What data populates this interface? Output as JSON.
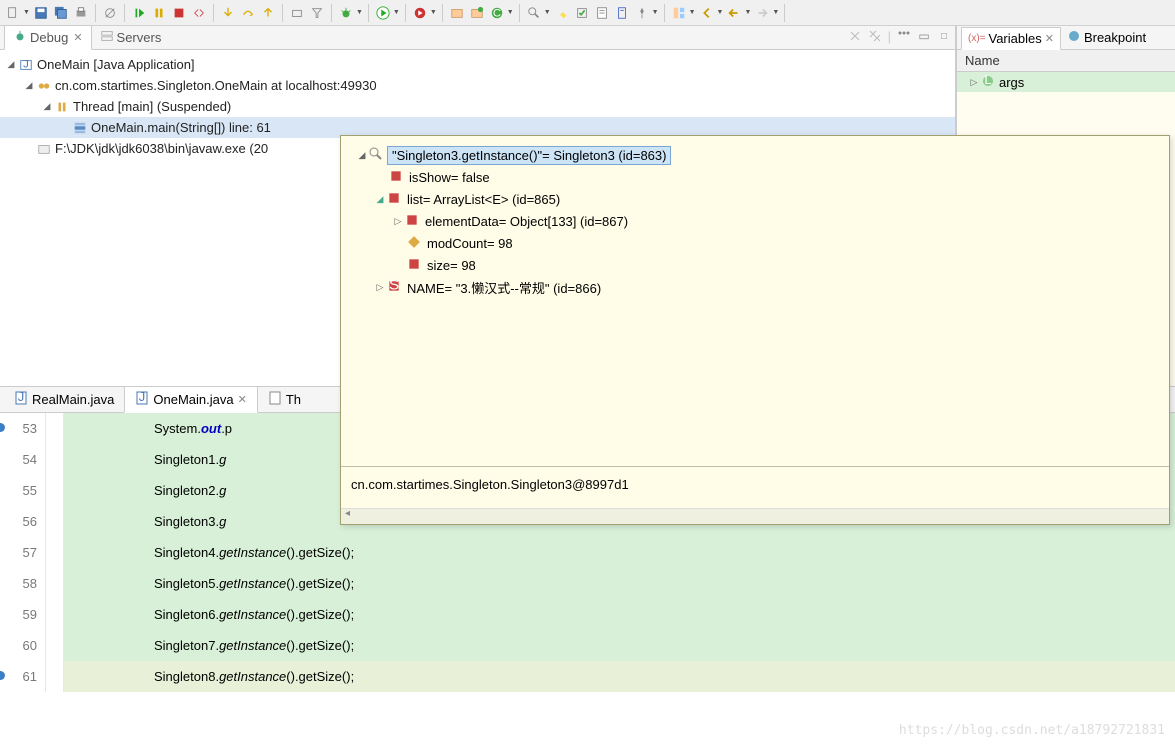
{
  "toolbar": {},
  "debug": {
    "tab_debug": "Debug",
    "tab_servers": "Servers",
    "tree": {
      "n0": "OneMain [Java Application]",
      "n1": "cn.com.startimes.Singleton.OneMain at localhost:49930",
      "n2": "Thread [main] (Suspended)",
      "n3": "OneMain.main(String[]) line: 61",
      "n4": "F:\\JDK\\jdk\\jdk6038\\bin\\javaw.exe (20"
    }
  },
  "vars": {
    "tab_vars": "Variables",
    "tab_bp": "Breakpoint",
    "header": "Name",
    "row0": "args"
  },
  "tooltip": {
    "root": "\"Singleton3.getInstance()\"= Singleton3  (id=863)",
    "isShow": "isShow= false",
    "list": "list= ArrayList<E>  (id=865)",
    "elementData": "elementData= Object[133]  (id=867)",
    "modCount": "modCount= 98",
    "size": "size= 98",
    "name": "NAME= \"3.懒汉式--常规\" (id=866)",
    "footer": "cn.com.startimes.Singleton.Singleton3@8997d1"
  },
  "editor": {
    "tab_real": "RealMain.java",
    "tab_one": "OneMain.java",
    "tab_th": "Th",
    "lines": {
      "l53a": "System.",
      "l53b": "out",
      "l53c": ".p",
      "l54a": "Singleton1.",
      "l54b": "g",
      "l55a": "Singleton2.",
      "l55b": "g",
      "l56a": "Singleton3.",
      "l56b": "g",
      "l57a": "Singleton4.",
      "l57b": "getInstance",
      "l57c": "().getSize();",
      "l58a": "Singleton5.",
      "l58b": "getInstance",
      "l58c": "().getSize();",
      "l59a": "Singleton6.",
      "l59b": "getInstance",
      "l59c": "().getSize();",
      "l60a": "Singleton7.",
      "l60b": "getInstance",
      "l60c": "().getSize();",
      "l61a": "Singleton8.",
      "l61b": "getInstance",
      "l61c": "().getSize();"
    },
    "nums": {
      "n53": "53",
      "n54": "54",
      "n55": "55",
      "n56": "56",
      "n57": "57",
      "n58": "58",
      "n59": "59",
      "n60": "60",
      "n61": "61"
    }
  },
  "watermark": "https://blog.csdn.net/a18792721831"
}
